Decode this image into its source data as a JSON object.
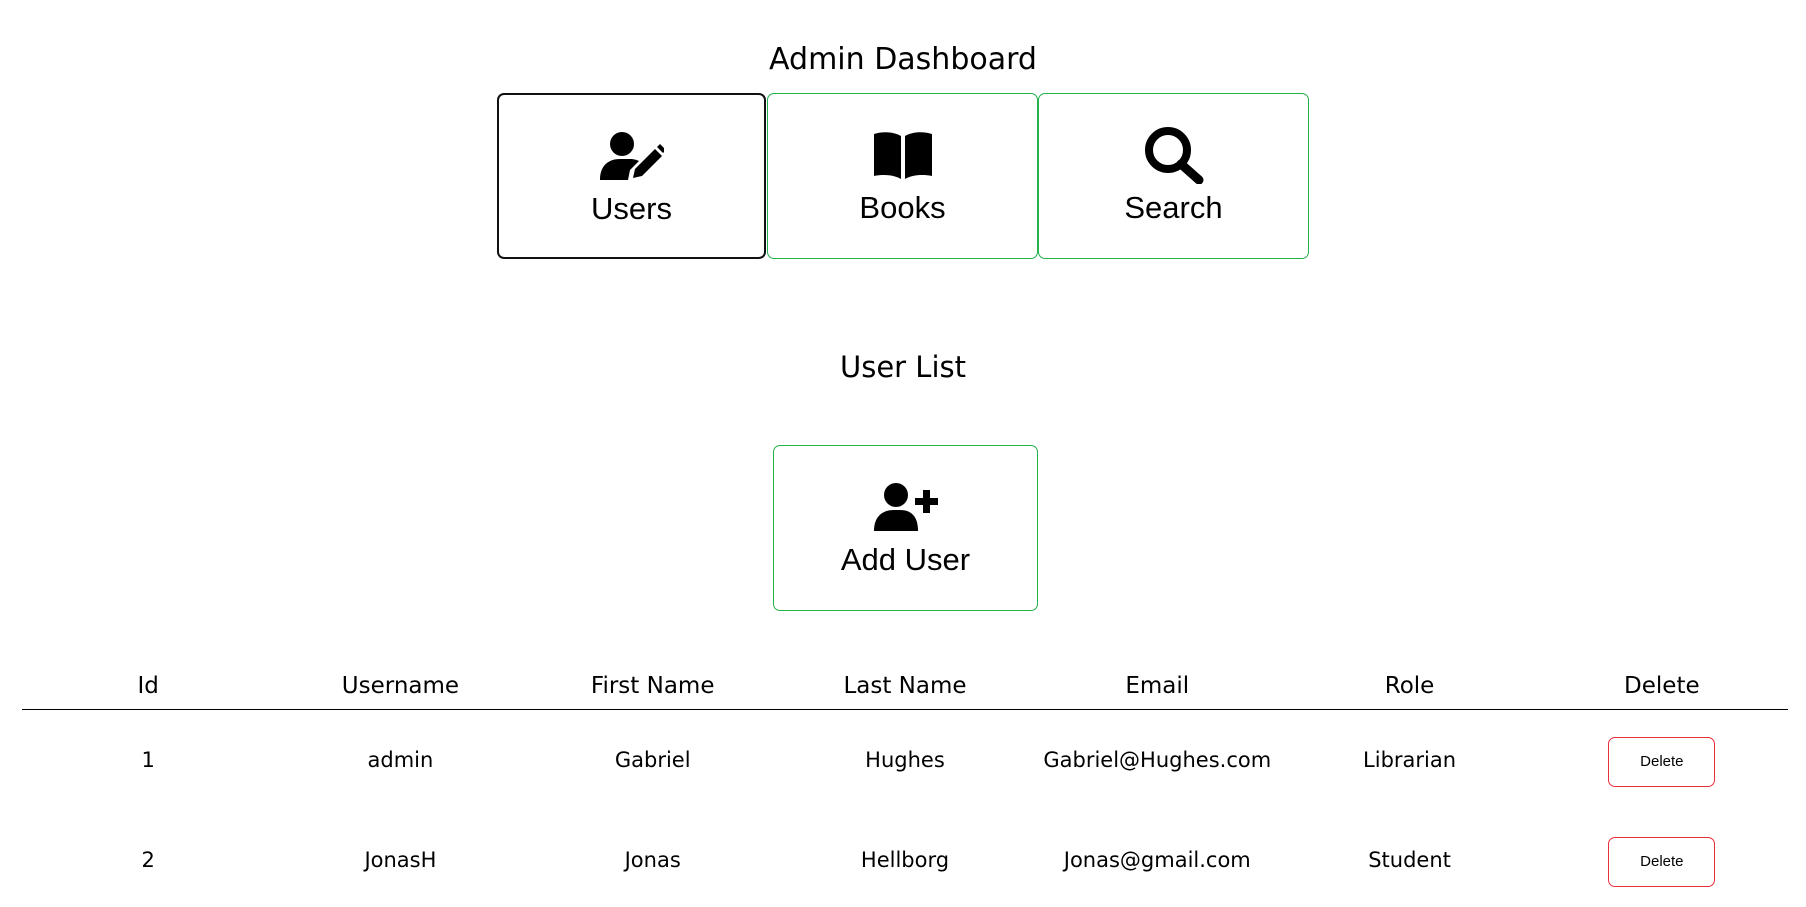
{
  "header": {
    "title": "Admin Dashboard"
  },
  "nav": {
    "items": [
      {
        "label": "Users",
        "icon": "user-edit-icon",
        "active": true
      },
      {
        "label": "Books",
        "icon": "book-open-icon",
        "active": false
      },
      {
        "label": "Search",
        "icon": "search-icon",
        "active": false
      }
    ]
  },
  "user_list": {
    "title": "User List",
    "add_button": {
      "label": "Add User",
      "icon": "user-plus-icon"
    },
    "columns": [
      "Id",
      "Username",
      "First Name",
      "Last Name",
      "Email",
      "Role",
      "Delete"
    ],
    "rows": [
      {
        "id": "1",
        "username": "admin",
        "first_name": "Gabriel",
        "last_name": "Hughes",
        "email": "Gabriel@Hughes.com",
        "role": "Librarian",
        "delete_label": "Delete"
      },
      {
        "id": "2",
        "username": "JonasH",
        "first_name": "Jonas",
        "last_name": "Hellborg",
        "email": "Jonas@gmail.com",
        "role": "Student",
        "delete_label": "Delete"
      }
    ]
  },
  "colors": {
    "nav_border": "#22b14c",
    "active_border": "#111111",
    "delete_border": "#e8303c"
  }
}
